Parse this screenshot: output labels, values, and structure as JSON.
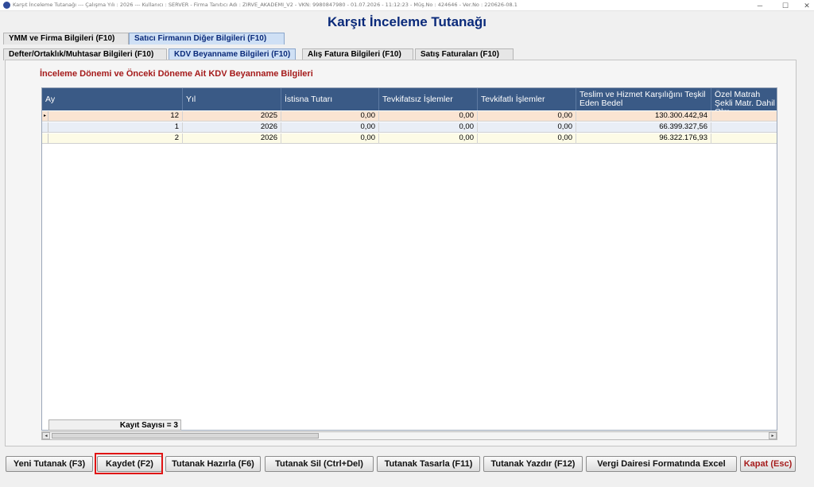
{
  "window": {
    "title_text": "Karşıt İnceleme Tutanağı  ---  Çalışma Yılı : 2026  ---  Kullanıcı : SERVER  -  Firma Tanıtıcı Adı : ZIRVE_AKADEMI_V2  -  VKN: 9980847980  -  01.07.2026  -  11:12:23  -  Müş.No : 424646  -  Ver.No : 220626-08.1",
    "minimize": "─",
    "maximize": "☐",
    "close": "✕"
  },
  "page_title": "Karşıt İnceleme Tutanağı",
  "tabs_top": [
    {
      "label": "YMM ve Firma Bilgileri (F10)",
      "active": false
    },
    {
      "label": "Satıcı Firmanın Diğer Bilgileri (F10)",
      "active": true
    }
  ],
  "tabs_sub": [
    {
      "label": "Defter/Ortaklık/Muhtasar Bilgileri (F10)",
      "active": false
    },
    {
      "label": "KDV Beyanname Bilgileri (F10)",
      "active": true
    },
    {
      "label": "Alış Fatura Bilgileri (F10)",
      "active": false
    },
    {
      "label": "Satış Faturaları (F10)",
      "active": false
    }
  ],
  "section_title": "İnceleme Dönemi ve Önceki Döneme Ait KDV Beyanname Bilgileri",
  "grid": {
    "columns": [
      "Ay",
      "Yıl",
      "İstisna Tutarı",
      "Tevkifatsız İşlemler",
      "Tevkifatlı İşlemler",
      "Teslim ve Hizmet Karşılığını Teşkil Eden Bedel",
      "Özel Matrah Şekli Matr. Dahil Olm."
    ],
    "rows": [
      {
        "indicator": "▸",
        "cells": [
          "12",
          "2025",
          "0,00",
          "0,00",
          "0,00",
          "130.300.442,94",
          ""
        ]
      },
      {
        "indicator": "",
        "cells": [
          "1",
          "2026",
          "0,00",
          "0,00",
          "0,00",
          "66.399.327,56",
          ""
        ]
      },
      {
        "indicator": "",
        "cells": [
          "2",
          "2026",
          "0,00",
          "0,00",
          "0,00",
          "96.322.176,93",
          ""
        ]
      }
    ],
    "record_count": "Kayıt Sayısı = 3"
  },
  "scroll": {
    "left": "◂",
    "right": "▸"
  },
  "buttons": [
    {
      "label": "Yeni Tutanak (F3)",
      "name": "new-report-button"
    },
    {
      "label": "Kaydet (F2)",
      "name": "save-button"
    },
    {
      "label": "Tutanak Hazırla (F6)",
      "name": "prepare-report-button"
    },
    {
      "label": "Tutanak Sil (Ctrl+Del)",
      "name": "delete-report-button"
    },
    {
      "label": "Tutanak Tasarla (F11)",
      "name": "design-report-button"
    },
    {
      "label": "Tutanak Yazdır (F12)",
      "name": "print-report-button"
    },
    {
      "label": "Vergi Dairesi Formatında Excel",
      "name": "tax-office-excel-button"
    },
    {
      "label": "Kapat (Esc)",
      "name": "close-button"
    }
  ],
  "colors": {
    "accent": "#0a2a7a",
    "header_bg": "#3a5a86",
    "section_title": "#a51b1b",
    "highlight": "#e01414"
  }
}
